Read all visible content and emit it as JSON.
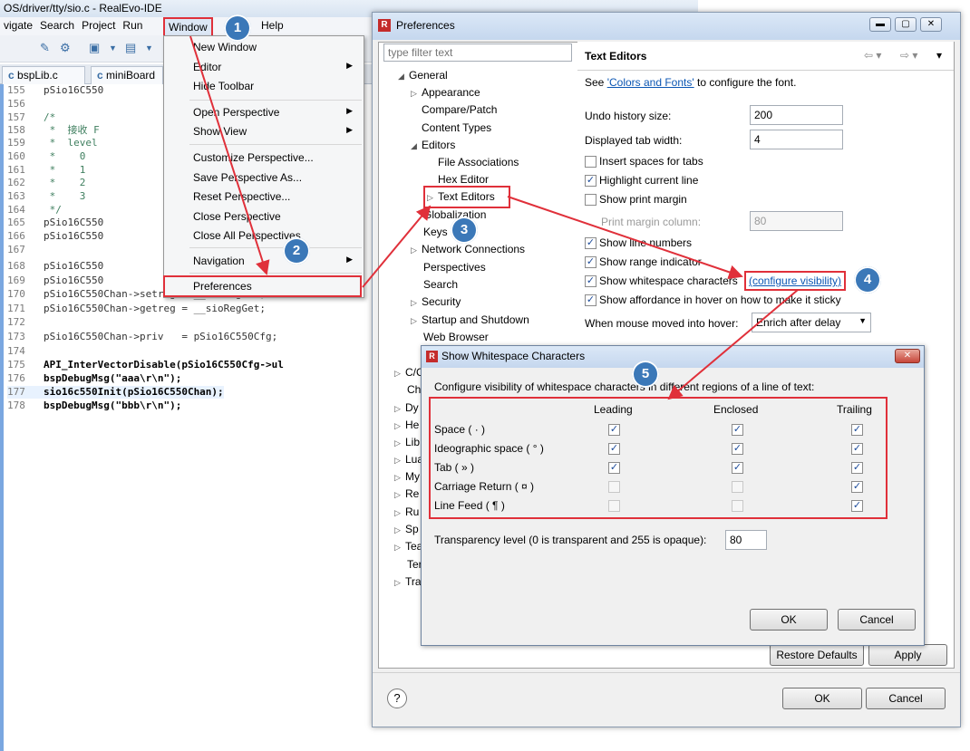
{
  "ide": {
    "title": "OS/driver/tty/sio.c - RealEvo-IDE",
    "menus": [
      "vigate",
      "Search",
      "Project",
      "Run",
      "Window",
      "Help"
    ],
    "tabs": [
      "bspLib.c",
      "miniBoard"
    ],
    "code_lines": [
      {
        "num": "155",
        "code": "pSio16C550"
      },
      {
        "num": "156",
        "code": ""
      },
      {
        "num": "157",
        "code": "/*"
      },
      {
        "num": "158",
        "code": " *  接收 F"
      },
      {
        "num": "159",
        "code": " *  level"
      },
      {
        "num": "160",
        "code": " *    0"
      },
      {
        "num": "161",
        "code": " *    1"
      },
      {
        "num": "162",
        "code": " *    2"
      },
      {
        "num": "163",
        "code": " *    3"
      },
      {
        "num": "164",
        "code": " */"
      },
      {
        "num": "165",
        "code": "pSio16C550"
      },
      {
        "num": "166",
        "code": "pSio16C550"
      },
      {
        "num": "167",
        "code": ""
      },
      {
        "num": "168",
        "code": "pSio16C550"
      },
      {
        "num": "169",
        "code": "pSio16C550"
      },
      {
        "num": "170",
        "code": "pSio16C550Chan->setreg = __sioRegSet;"
      },
      {
        "num": "171",
        "code": "pSio16C550Chan->getreg = __sioRegGet;"
      },
      {
        "num": "172",
        "code": ""
      },
      {
        "num": "173",
        "code": "pSio16C550Chan->priv   = pSio16C550Cfg;"
      },
      {
        "num": "174",
        "code": ""
      },
      {
        "num": "175",
        "code": "API_InterVectorDisable(pSio16C550Cfg->ul"
      },
      {
        "num": "176",
        "code": "bspDebugMsg(\"aaa\\r\\n\");"
      },
      {
        "num": "177",
        "code": "sio16c550Init(pSio16C550Chan);"
      },
      {
        "num": "178",
        "code": "bspDebugMsg(\"bbb\\r\\n\");"
      }
    ]
  },
  "window_menu": {
    "items": [
      {
        "label": "New Window",
        "arrow": false
      },
      {
        "label": "Editor",
        "arrow": true
      },
      {
        "label": "Hide Toolbar",
        "arrow": false
      },
      {
        "label": "Open Perspective",
        "arrow": true
      },
      {
        "label": "Show View",
        "arrow": true
      },
      {
        "label": "Customize Perspective...",
        "arrow": false
      },
      {
        "label": "Save Perspective As...",
        "arrow": false
      },
      {
        "label": "Reset Perspective...",
        "arrow": false
      },
      {
        "label": "Close Perspective",
        "arrow": false
      },
      {
        "label": "Close All Perspectives",
        "arrow": false
      },
      {
        "label": "Navigation",
        "arrow": true
      },
      {
        "label": "Preferences",
        "arrow": false
      }
    ]
  },
  "prefs": {
    "title": "Preferences",
    "filter_placeholder": "type filter text",
    "tree": [
      {
        "label": "General",
        "arrow": "◢"
      },
      {
        "label": "Appearance",
        "arrow": "▷"
      },
      {
        "label": "Compare/Patch",
        "arrow": ""
      },
      {
        "label": "Content Types",
        "arrow": ""
      },
      {
        "label": "Editors",
        "arrow": "◢"
      },
      {
        "label": "File Associations",
        "arrow": ""
      },
      {
        "label": "Hex Editor",
        "arrow": ""
      },
      {
        "label": "Text Editors",
        "arrow": "▷"
      },
      {
        "label": "Globalization",
        "arrow": ""
      },
      {
        "label": "Keys",
        "arrow": ""
      },
      {
        "label": "Network Connections",
        "arrow": "▷"
      },
      {
        "label": "Perspectives",
        "arrow": ""
      },
      {
        "label": "Search",
        "arrow": ""
      },
      {
        "label": "Security",
        "arrow": "▷"
      },
      {
        "label": "Startup and Shutdown",
        "arrow": "▷"
      },
      {
        "label": "Web Browser",
        "arrow": ""
      },
      {
        "label": "C/C",
        "arrow": "▷"
      },
      {
        "label": "Ch",
        "arrow": ""
      },
      {
        "label": "Dy",
        "arrow": "▷"
      },
      {
        "label": "He",
        "arrow": "▷"
      },
      {
        "label": "Lib",
        "arrow": "▷"
      },
      {
        "label": "Lua",
        "arrow": "▷"
      },
      {
        "label": "My",
        "arrow": "▷"
      },
      {
        "label": "Re",
        "arrow": "▷"
      },
      {
        "label": "Ru",
        "arrow": "▷"
      },
      {
        "label": "Sp",
        "arrow": "▷"
      },
      {
        "label": "Tea",
        "arrow": "▷"
      },
      {
        "label": "Ter",
        "arrow": ""
      },
      {
        "label": "Tra",
        "arrow": "▷"
      }
    ],
    "page_title": "Text Editors",
    "colors_prefix": "See ",
    "colors_link": "'Colors and Fonts'",
    "colors_suffix": " to configure the font.",
    "undo_label": "Undo history size:",
    "undo_value": "200",
    "tab_width_label": "Displayed tab width:",
    "tab_width_value": "4",
    "insert_spaces": "Insert spaces for tabs",
    "highlight_line": "Highlight current line",
    "show_margin": "Show print margin",
    "margin_col_label": "Print margin column:",
    "margin_col_value": "80",
    "show_line_numbers": "Show line numbers",
    "show_range": "Show range indicator",
    "show_whitespace": "Show whitespace characters",
    "configure_visibility": "(configure visibility)",
    "show_affordance": "Show affordance in hover on how to make it sticky",
    "hover_label": "When mouse moved into hover:",
    "hover_value": "Enrich after delay",
    "restore_defaults": "Restore Defaults",
    "apply": "Apply",
    "ok": "OK",
    "cancel": "Cancel",
    "help_icon": "?"
  },
  "whitespace_dialog": {
    "title": "Show Whitespace Characters",
    "intro": "Configure visibility of whitespace characters in different regions of a line of text:",
    "columns": [
      "Leading",
      "Enclosed",
      "Trailing"
    ],
    "rows": [
      {
        "label": "Space ( · )",
        "leading": true,
        "enclosed": true,
        "trailing": true,
        "enabled": [
          true,
          true,
          true
        ]
      },
      {
        "label": "Ideographic space ( ° )",
        "leading": true,
        "enclosed": true,
        "trailing": true,
        "enabled": [
          true,
          true,
          true
        ]
      },
      {
        "label": "Tab ( » )",
        "leading": true,
        "enclosed": true,
        "trailing": true,
        "enabled": [
          true,
          true,
          true
        ]
      },
      {
        "label": "Carriage Return ( ¤ )",
        "leading": false,
        "enclosed": false,
        "trailing": true,
        "enabled": [
          false,
          false,
          true
        ]
      },
      {
        "label": "Line Feed ( ¶ )",
        "leading": false,
        "enclosed": false,
        "trailing": true,
        "enabled": [
          false,
          false,
          true
        ]
      }
    ],
    "transparency_label": "Transparency level (0 is transparent and 255 is opaque):",
    "transparency_value": "80",
    "ok": "OK",
    "cancel": "Cancel"
  },
  "annotations": [
    "1",
    "2",
    "3",
    "4",
    "5"
  ],
  "colors": {
    "accent": "#3b78b8",
    "highlight": "#e0303a"
  }
}
